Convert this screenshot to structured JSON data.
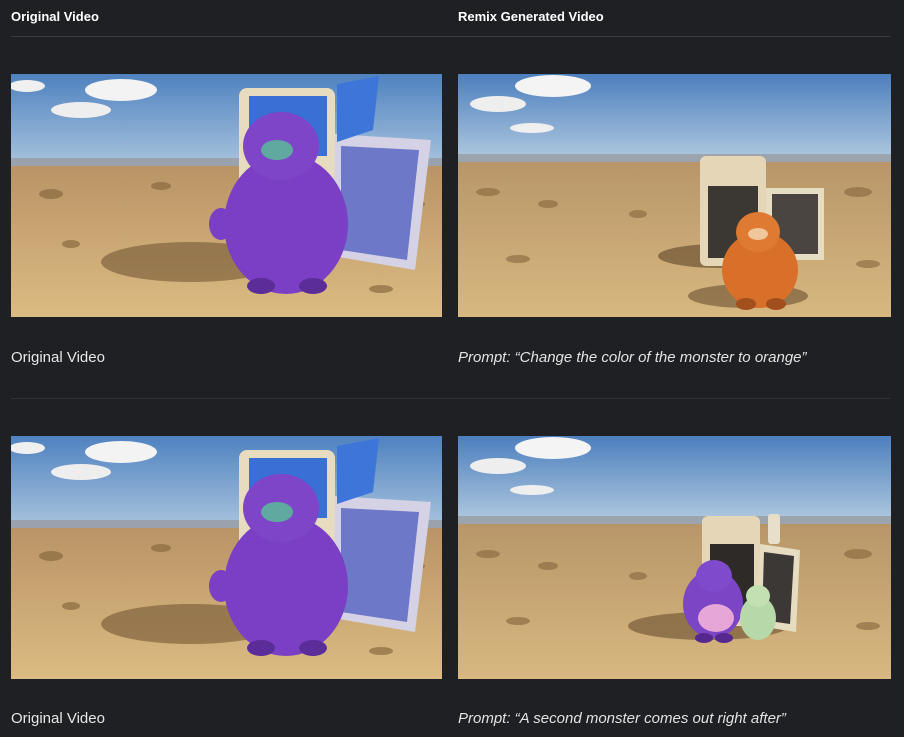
{
  "header": {
    "original_label": "Original Video",
    "remix_label": "Remix Generated Video"
  },
  "rows": [
    {
      "original_caption": "Original Video",
      "remix_prompt": "Prompt: “Change the color of the monster to orange”"
    },
    {
      "original_caption": "Original Video",
      "remix_prompt": "Prompt: “A second monster comes out right after”"
    }
  ],
  "colors": {
    "background": "#1f2023",
    "monster_purple": "#7a3fc4",
    "monster_orange": "#d9702a",
    "monster_green": "#b7d8a8",
    "sand": "#d9b577",
    "sky": "#5f8fc7"
  }
}
